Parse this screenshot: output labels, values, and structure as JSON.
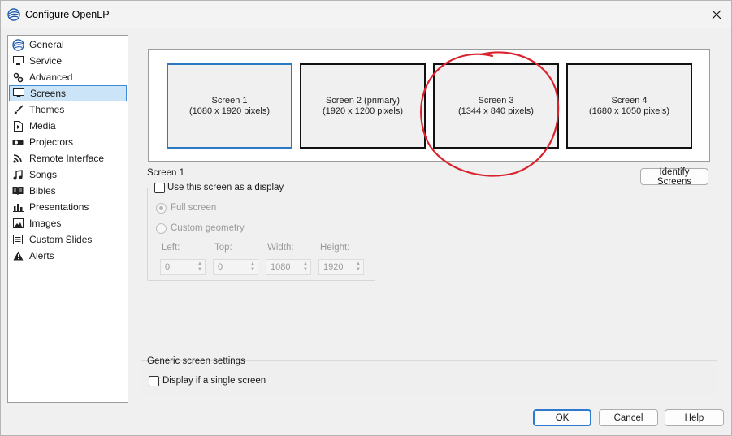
{
  "window": {
    "title": "Configure OpenLP"
  },
  "sidebar": {
    "items": [
      {
        "label": "General",
        "icon": "openlp-logo-icon"
      },
      {
        "label": "Service",
        "icon": "monitor-icon"
      },
      {
        "label": "Advanced",
        "icon": "gears-icon"
      },
      {
        "label": "Screens",
        "icon": "display-icon",
        "selected": true
      },
      {
        "label": "Themes",
        "icon": "paintbrush-icon"
      },
      {
        "label": "Media",
        "icon": "media-file-icon"
      },
      {
        "label": "Projectors",
        "icon": "projector-icon"
      },
      {
        "label": "Remote Interface",
        "icon": "rss-icon"
      },
      {
        "label": "Songs",
        "icon": "music-note-icon"
      },
      {
        "label": "Bibles",
        "icon": "book-icon"
      },
      {
        "label": "Presentations",
        "icon": "bar-chart-icon"
      },
      {
        "label": "Images",
        "icon": "image-icon"
      },
      {
        "label": "Custom Slides",
        "icon": "custom-slide-icon"
      },
      {
        "label": "Alerts",
        "icon": "warning-icon"
      }
    ]
  },
  "screens": [
    {
      "name": "Screen 1",
      "resolution": "(1080 x 1920 pixels)",
      "selected": true
    },
    {
      "name": "Screen 2 (primary)",
      "resolution": "(1920 x 1200 pixels)"
    },
    {
      "name": "Screen 3",
      "resolution": "(1344 x 840 pixels)",
      "annotated": true
    },
    {
      "name": "Screen 4",
      "resolution": "(1680 x 1050 pixels)"
    }
  ],
  "screen_settings": {
    "heading": "Screen 1",
    "use_as_display_label": "Use this screen as a display",
    "use_as_display_checked": false,
    "full_screen_label": "Full screen",
    "full_screen_checked": true,
    "custom_geometry_label": "Custom geometry",
    "custom_geometry_checked": false,
    "left_label": "Left:",
    "top_label": "Top:",
    "width_label": "Width:",
    "height_label": "Height:",
    "left_value": "0",
    "top_value": "0",
    "width_value": "1080",
    "height_value": "1920"
  },
  "identify_button": "Identify Screens",
  "generic": {
    "heading": "Generic screen settings",
    "single_screen_label": "Display if a single screen",
    "single_screen_checked": false
  },
  "buttons": {
    "ok": "OK",
    "cancel": "Cancel",
    "help": "Help"
  },
  "colors": {
    "selection_bg": "#cce4f7",
    "selection_border": "#2b79c2",
    "annotation": "#d9232e"
  }
}
